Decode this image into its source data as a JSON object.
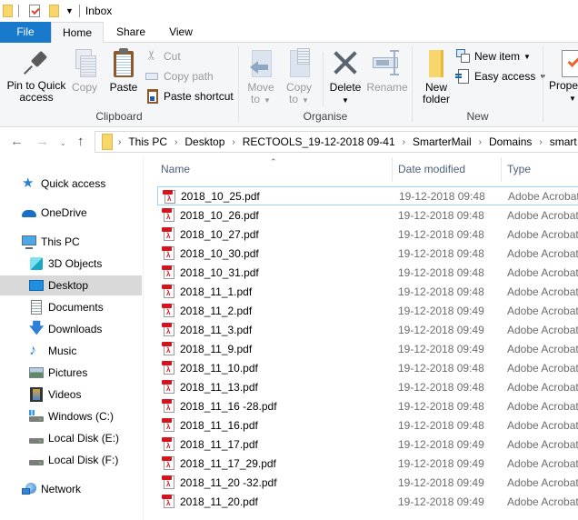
{
  "window": {
    "title": "Inbox"
  },
  "quick_access_toolbar": {
    "icons": [
      "folder-icon",
      "properties-icon",
      "new-folder-icon",
      "customize-dropdown-icon"
    ]
  },
  "ribbon_tabs": [
    {
      "label": "File",
      "active": false
    },
    {
      "label": "Home",
      "active": true
    },
    {
      "label": "Share",
      "active": false
    },
    {
      "label": "View",
      "active": false
    }
  ],
  "ribbon": {
    "clipboard": {
      "label": "Clipboard",
      "pin_line1": "Pin to Quick",
      "pin_line2": "access",
      "copy": "Copy",
      "paste": "Paste",
      "cut": "Cut",
      "copy_path": "Copy path",
      "paste_shortcut": "Paste shortcut"
    },
    "organise": {
      "label": "Organise",
      "move_line1": "Move",
      "move_line2": "to",
      "copyto_line1": "Copy",
      "copyto_line2": "to",
      "delete": "Delete",
      "rename": "Rename"
    },
    "new": {
      "label": "New",
      "new_folder_line1": "New",
      "new_folder_line2": "folder",
      "new_item": "New item",
      "easy_access": "Easy access"
    },
    "open": {
      "properties": "Prope"
    }
  },
  "address_bar": {
    "breadcrumbs": [
      "This PC",
      "Desktop",
      "RECTOOLS_19-12-2018 09-41",
      "SmarterMail",
      "Domains",
      "smart"
    ]
  },
  "sidebar": {
    "items": [
      {
        "label": "Quick access",
        "icon": "quick-access-star-icon"
      },
      {
        "label": "OneDrive",
        "icon": "onedrive-cloud-icon"
      },
      {
        "label": "This PC",
        "icon": "this-pc-icon"
      },
      {
        "label": "3D Objects",
        "icon": "3d-objects-icon"
      },
      {
        "label": "Desktop",
        "icon": "desktop-icon",
        "selected": true
      },
      {
        "label": "Documents",
        "icon": "documents-icon"
      },
      {
        "label": "Downloads",
        "icon": "downloads-icon"
      },
      {
        "label": "Music",
        "icon": "music-icon"
      },
      {
        "label": "Pictures",
        "icon": "pictures-icon"
      },
      {
        "label": "Videos",
        "icon": "videos-icon"
      },
      {
        "label": "Windows (C:)",
        "icon": "windows-drive-icon"
      },
      {
        "label": "Local Disk (E:)",
        "icon": "drive-icon"
      },
      {
        "label": "Local Disk (F:)",
        "icon": "drive-icon"
      },
      {
        "label": "Network",
        "icon": "network-icon"
      }
    ]
  },
  "file_list": {
    "columns": [
      "Name",
      "Date modified",
      "Type"
    ],
    "sort_column": "Name",
    "files": [
      {
        "name": "2018_10_25.pdf",
        "date": "19-12-2018 09:48",
        "type": "Adobe Acrobat"
      },
      {
        "name": "2018_10_26.pdf",
        "date": "19-12-2018 09:48",
        "type": "Adobe Acrobat"
      },
      {
        "name": "2018_10_27.pdf",
        "date": "19-12-2018 09:48",
        "type": "Adobe Acrobat"
      },
      {
        "name": "2018_10_30.pdf",
        "date": "19-12-2018 09:48",
        "type": "Adobe Acrobat"
      },
      {
        "name": "2018_10_31.pdf",
        "date": "19-12-2018 09:48",
        "type": "Adobe Acrobat"
      },
      {
        "name": "2018_11_1.pdf",
        "date": "19-12-2018 09:48",
        "type": "Adobe Acrobat"
      },
      {
        "name": "2018_11_2.pdf",
        "date": "19-12-2018 09:49",
        "type": "Adobe Acrobat"
      },
      {
        "name": "2018_11_3.pdf",
        "date": "19-12-2018 09:49",
        "type": "Adobe Acrobat"
      },
      {
        "name": "2018_11_9.pdf",
        "date": "19-12-2018 09:49",
        "type": "Adobe Acrobat"
      },
      {
        "name": "2018_11_10.pdf",
        "date": "19-12-2018 09:48",
        "type": "Adobe Acrobat"
      },
      {
        "name": "2018_11_13.pdf",
        "date": "19-12-2018 09:48",
        "type": "Adobe Acrobat"
      },
      {
        "name": "2018_11_16 -28.pdf",
        "date": "19-12-2018 09:48",
        "type": "Adobe Acrobat"
      },
      {
        "name": "2018_11_16.pdf",
        "date": "19-12-2018 09:48",
        "type": "Adobe Acrobat"
      },
      {
        "name": "2018_11_17.pdf",
        "date": "19-12-2018 09:49",
        "type": "Adobe Acrobat"
      },
      {
        "name": "2018_11_17_29.pdf",
        "date": "19-12-2018 09:49",
        "type": "Adobe Acrobat"
      },
      {
        "name": "2018_11_20 -32.pdf",
        "date": "19-12-2018 09:49",
        "type": "Adobe Acrobat"
      },
      {
        "name": "2018_11_20.pdf",
        "date": "19-12-2018 09:49",
        "type": "Adobe Acrobat"
      }
    ]
  },
  "colors": {
    "file_tab": "#1979ca",
    "ribbon_bg": "#f5f6f7",
    "selected_nav": "#d9d9d9",
    "focus_border": "#99d1ff",
    "pdf_red": "#d4141c"
  }
}
